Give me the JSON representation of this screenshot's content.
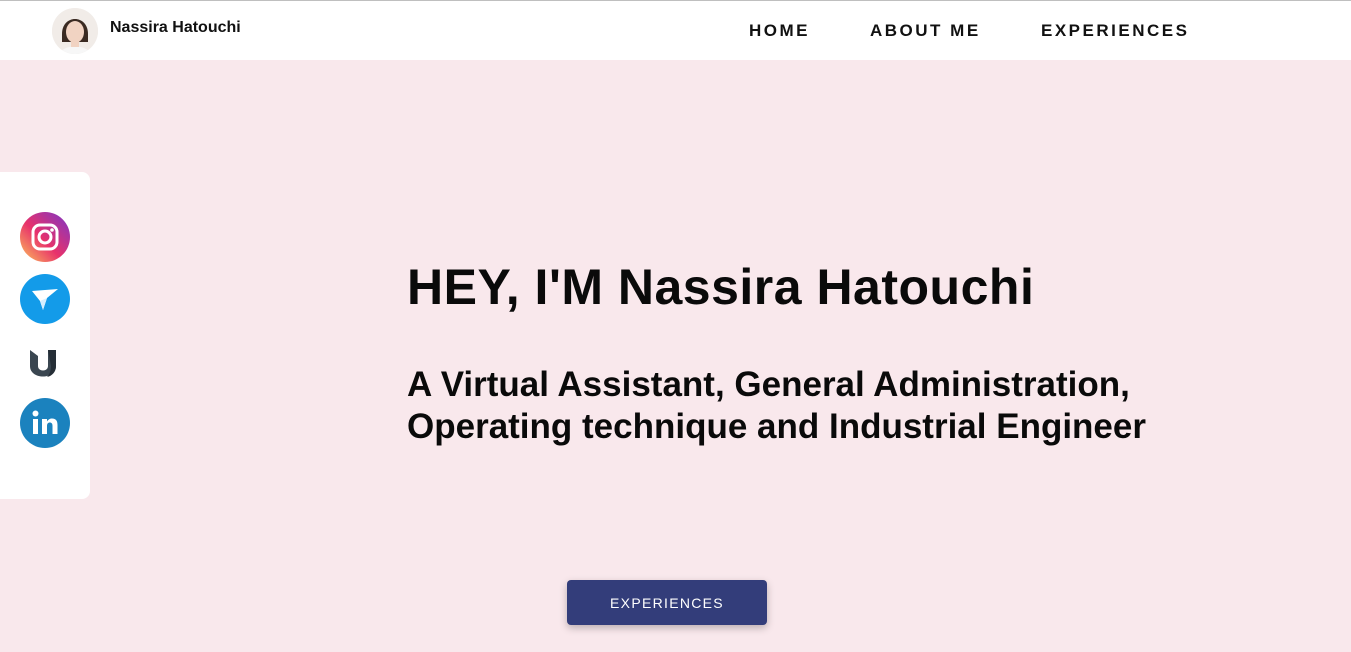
{
  "header": {
    "brand_name": "Nassira Hatouchi",
    "nav": {
      "home": "HOME",
      "about": "ABOUT ME",
      "experiences": "EXPERIENCES"
    }
  },
  "social_links": [
    {
      "name": "instagram-icon"
    },
    {
      "name": "freelancer-icon"
    },
    {
      "name": "upwork-icon"
    },
    {
      "name": "linkedin-icon"
    }
  ],
  "hero": {
    "title": "HEY, I'M Nassira Hatouchi",
    "subtitle": "A Virtual Assistant, General Administration, Operating technique and Industrial Engineer",
    "cta_label": "EXPERIENCES"
  },
  "colors": {
    "page_background": "#f9e8ec",
    "header_background": "#ffffff",
    "cta_background": "#333d7a",
    "text": "#0a0a0a"
  }
}
